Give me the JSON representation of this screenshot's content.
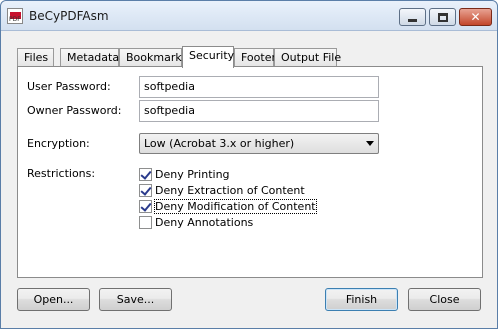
{
  "window": {
    "title": "BeCyPDFAsm",
    "icon_text": "PDF"
  },
  "tabs": [
    {
      "label": "Files"
    },
    {
      "label": "Metadata"
    },
    {
      "label": "Bookmarks"
    },
    {
      "label": "Security",
      "active": true
    },
    {
      "label": "Footer"
    },
    {
      "label": "Output File"
    }
  ],
  "security": {
    "user_password_label": "User Password:",
    "user_password_value": "softpedia",
    "owner_password_label": "Owner Password:",
    "owner_password_value": "softpedia",
    "encryption_label": "Encryption:",
    "encryption_value": "Low (Acrobat 3.x or higher)",
    "restrictions_label": "Restrictions:",
    "restrictions": [
      {
        "label": "Deny Printing",
        "checked": true
      },
      {
        "label": "Deny Extraction of Content",
        "checked": true
      },
      {
        "label": "Deny Modification of Content",
        "checked": true
      },
      {
        "label": "Deny Annotations",
        "checked": false
      }
    ]
  },
  "buttons": {
    "open": "Open...",
    "save": "Save...",
    "finish": "Finish",
    "close": "Close"
  }
}
